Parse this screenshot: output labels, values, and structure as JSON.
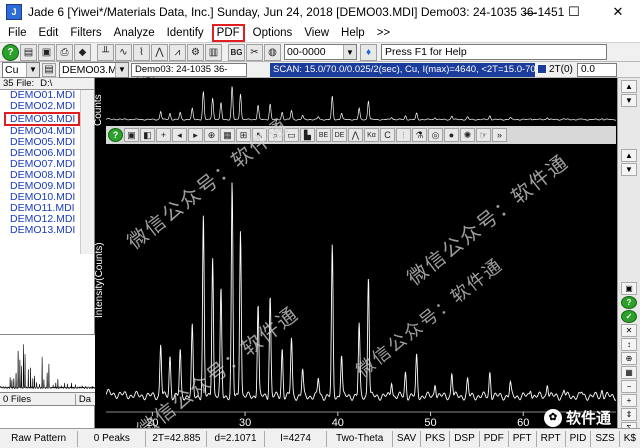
{
  "window": {
    "title": "Jade 6 [Yiwei*/Materials Data, Inc.] Sunday, Jun 24, 2018 [DEMO03.MDI] Demo03: 24-1035 36-1451",
    "minimize": "—",
    "maximize": "☐",
    "close": "✕"
  },
  "menu": [
    "File",
    "Edit",
    "Filters",
    "Analyze",
    "Identify",
    "PDF",
    "Options",
    "View",
    "Help",
    ">>"
  ],
  "toolbar": {
    "pdf_select": "00-0000",
    "help_text": "Press F1 for Help"
  },
  "toolbar2": {
    "element_select": "Cu",
    "file_select": "DEMO03.MDI",
    "pattern_title": "Demo03: 24-1035 36-1451",
    "scan_info": "SCAN: 15.0/70.0/0.025/2(sec), Cu, I(max)=4640, <2T=15.0-70.0>",
    "theta_label": "2T(0)",
    "theta_value": "0.0"
  },
  "files": {
    "count_label": "35 File:",
    "dir_label": "D:\\",
    "items": [
      "DEMO01.MDI",
      "DEMO02.MDI",
      "DEMO03.MDI",
      "DEMO04.MDI",
      "DEMO05.MDI",
      "DEMO06.MDI",
      "DEMO07.MDI",
      "DEMO08.MDI",
      "DEMO09.MDI",
      "DEMO10.MDI",
      "DEMO11.MDI",
      "DEMO12.MDI",
      "DEMO13.MDI"
    ],
    "selected_index": 2,
    "files_label": "0 Files",
    "files_tab": "Da"
  },
  "chart_labels": {
    "upper_ylabel": "Counts",
    "main_ylabel": "Intensity(Counts)",
    "xticks": [
      "20",
      "30",
      "40",
      "50",
      "60"
    ]
  },
  "chart_data": {
    "type": "line",
    "xlabel": "",
    "ylabel": "Intensity(Counts)",
    "xlim": [
      15,
      70
    ],
    "x_ticks": [
      20,
      30,
      40,
      50,
      60
    ],
    "peaks": [
      {
        "x": 20.9,
        "y": 1300
      },
      {
        "x": 21.9,
        "y": 1050
      },
      {
        "x": 23.0,
        "y": 1150
      },
      {
        "x": 24.3,
        "y": 1600
      },
      {
        "x": 25.5,
        "y": 3700
      },
      {
        "x": 26.5,
        "y": 3000
      },
      {
        "x": 27.4,
        "y": 2300
      },
      {
        "x": 28.6,
        "y": 4300
      },
      {
        "x": 29.5,
        "y": 3500
      },
      {
        "x": 31.4,
        "y": 2050
      },
      {
        "x": 32.7,
        "y": 2200
      },
      {
        "x": 34.0,
        "y": 1200
      },
      {
        "x": 35.0,
        "y": 1400
      },
      {
        "x": 36.2,
        "y": 800
      },
      {
        "x": 37.9,
        "y": 650
      },
      {
        "x": 39.4,
        "y": 3100
      },
      {
        "x": 40.4,
        "y": 1100
      },
      {
        "x": 42.3,
        "y": 1650
      },
      {
        "x": 43.3,
        "y": 2600
      },
      {
        "x": 45.8,
        "y": 600
      },
      {
        "x": 47.3,
        "y": 750
      },
      {
        "x": 48.5,
        "y": 1050
      },
      {
        "x": 50.5,
        "y": 560
      },
      {
        "x": 52.3,
        "y": 750
      },
      {
        "x": 54.0,
        "y": 600
      },
      {
        "x": 56.4,
        "y": 760
      },
      {
        "x": 58.6,
        "y": 540
      },
      {
        "x": 60.8,
        "y": 450
      },
      {
        "x": 62.6,
        "y": 560
      },
      {
        "x": 64.4,
        "y": 420
      },
      {
        "x": 66.3,
        "y": 380
      },
      {
        "x": 68.5,
        "y": 420
      }
    ],
    "background": 300,
    "ylim": [
      0,
      4640
    ]
  },
  "watermarks": [
    "微信公众号：软件通",
    "微信公众号：软件通",
    "微信公众号：软件通",
    "微信公众号：软件通"
  ],
  "brand": "软件通",
  "status": [
    "Raw Pattern",
    "0 Peaks",
    "2T=42.885",
    "d=2.1071",
    "I=4274",
    "Two-Theta",
    "SAV",
    "PKS",
    "DSP",
    "PDF",
    "PFT",
    "RPT",
    "PID",
    "SZS",
    "K$"
  ]
}
